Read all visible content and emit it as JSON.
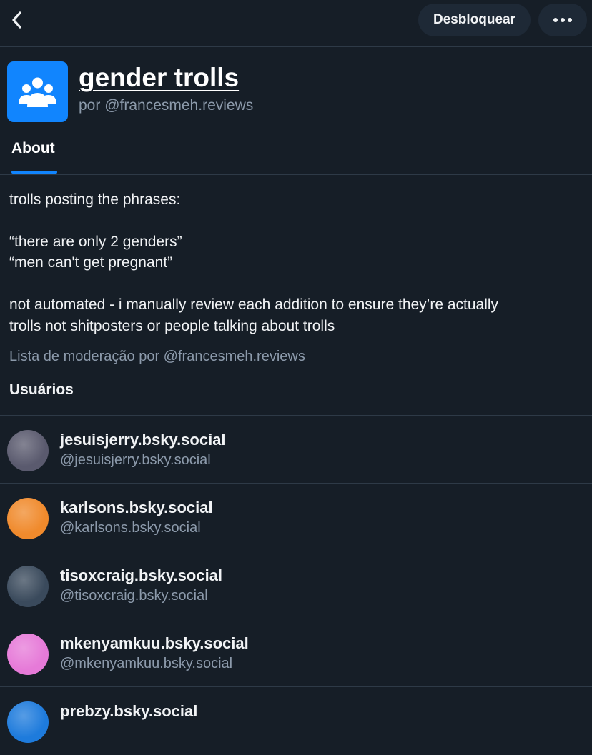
{
  "header": {
    "unblock_label": "Desbloquear",
    "back_icon": "chevron-left-icon",
    "more_icon": "ellipsis-icon"
  },
  "list": {
    "title": "gender trolls",
    "byline_prefix": "por",
    "owner_handle": "@francesmeh.reviews",
    "avatar_icon": "people-group-icon",
    "avatar_color": "#1185fe"
  },
  "tabs": [
    {
      "label": "About",
      "active": true
    }
  ],
  "description": {
    "line1": "trolls posting the phrases:",
    "quote1": "“there are only 2 genders”",
    "quote2": "“men can't get pregnant”",
    "line4": "not automated - i manually review each addition to ensure they’re actually",
    "line5": "trolls not shitposters or people talking about trolls"
  },
  "moderation_line": "Lista de moderação por @francesmeh.reviews",
  "users_heading": "Usuários",
  "users": [
    {
      "name": "jesuisjerry.bsky.social",
      "handle": "@jesuisjerry.bsky.social",
      "avatar_color": "#5a5a6e"
    },
    {
      "name": "karlsons.bsky.social",
      "handle": "@karlsons.bsky.social",
      "avatar_color": "#f08a2c"
    },
    {
      "name": "tisoxcraig.bsky.social",
      "handle": "@tisoxcraig.bsky.social",
      "avatar_color": "#3a4a5c"
    },
    {
      "name": "mkenyamkuu.bsky.social",
      "handle": "@mkenyamkuu.bsky.social",
      "avatar_color": "#e67ad8"
    },
    {
      "name": "prebzy.bsky.social",
      "handle": "",
      "avatar_color": "#1e7bdc"
    }
  ],
  "colors": {
    "background": "#161e27",
    "accent": "#1185fe",
    "secondary_text": "#8c9aab",
    "divider": "#2e3a47"
  }
}
